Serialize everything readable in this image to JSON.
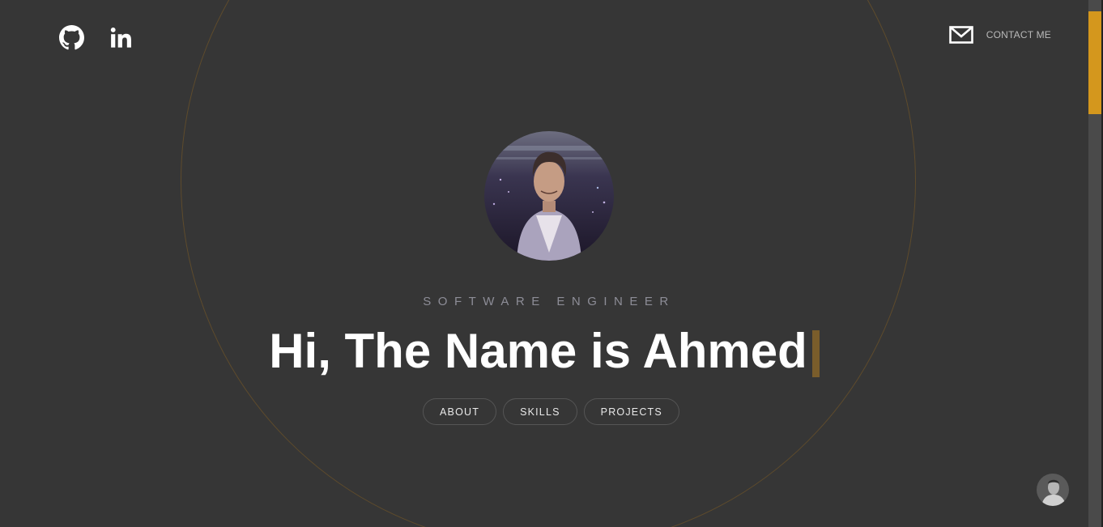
{
  "header": {
    "github_icon": "github-icon",
    "linkedin_icon": "linkedin-icon",
    "contact_icon": "mail-icon",
    "contact_label": "CONTACT ME"
  },
  "hero": {
    "subtitle": "SOFTWARE ENGINEER",
    "headline": "Hi, The Name is Ahmed"
  },
  "nav": {
    "about": "ABOUT",
    "skills": "SKILLS",
    "projects": "PROJECTS"
  },
  "colors": {
    "background": "#363636",
    "accent": "#d4971d",
    "ring": "#5e4b2c",
    "cursor": "#7a5d2b"
  }
}
